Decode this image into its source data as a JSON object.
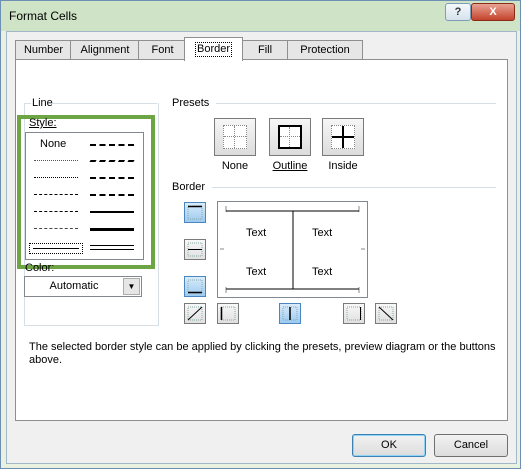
{
  "window": {
    "title": "Format Cells",
    "help_label": "?",
    "close_label": "X"
  },
  "tabs": [
    {
      "label": "Number",
      "active": false
    },
    {
      "label": "Alignment",
      "active": false
    },
    {
      "label": "Font",
      "active": false
    },
    {
      "label": "Border",
      "active": true
    },
    {
      "label": "Fill",
      "active": false
    },
    {
      "label": "Protection",
      "active": false
    }
  ],
  "line": {
    "group_label": "Line",
    "style_label": "Style:",
    "style_none": "None",
    "color_label": "Color:",
    "color_value": "Automatic"
  },
  "presets": {
    "group_label": "Presets",
    "items": [
      {
        "label": "None",
        "icon": "preset-none-icon"
      },
      {
        "label": "Outline",
        "icon": "preset-outline-icon"
      },
      {
        "label": "Inside",
        "icon": "preset-inside-icon"
      }
    ]
  },
  "border": {
    "group_label": "Border",
    "preview_cells": [
      "Text",
      "Text",
      "Text",
      "Text"
    ]
  },
  "description": "The selected border style can be applied by clicking the presets, preview diagram or the buttons above.",
  "buttons": {
    "ok": "OK",
    "cancel": "Cancel"
  },
  "colors": {
    "highlight": "#6ea544",
    "title_bar": "#cfe3c6",
    "toggle_on": "#9ccaf0"
  }
}
